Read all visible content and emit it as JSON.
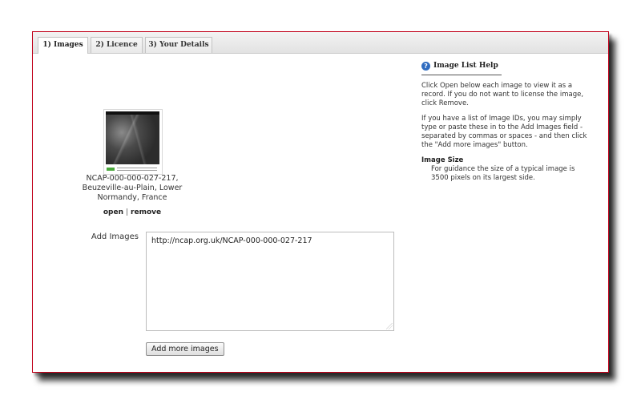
{
  "tabs": [
    {
      "label": "1) Images",
      "active": true
    },
    {
      "label": "2) Licence",
      "active": false
    },
    {
      "label": "3) Your Details",
      "active": false
    }
  ],
  "image_item": {
    "caption": "NCAP-000-000-027-217, Beuzeville-au-Plain, Lower Normandy, France",
    "open_label": "open",
    "separator": "|",
    "remove_label": "remove"
  },
  "add_images": {
    "label": "Add Images",
    "value": "http://ncap.org.uk/NCAP-000-000-027-217",
    "button_label": "Add more images"
  },
  "help": {
    "icon_glyph": "?",
    "title": "Image List Help",
    "para1": "Click Open below each image to view it as a record. If you do not want to license the image, click Remove.",
    "para2": "If you have a list of Image IDs, you may simply type or paste these in to the Add Images field - separated by commas or spaces - and then click the \"Add more images\" button.",
    "size_title": "Image Size",
    "size_text": "For guidance the size of a typical image is 3500 pixels on its largest side."
  },
  "colors": {
    "frame_border": "#c0001a",
    "help_icon": "#2f6cc0"
  }
}
